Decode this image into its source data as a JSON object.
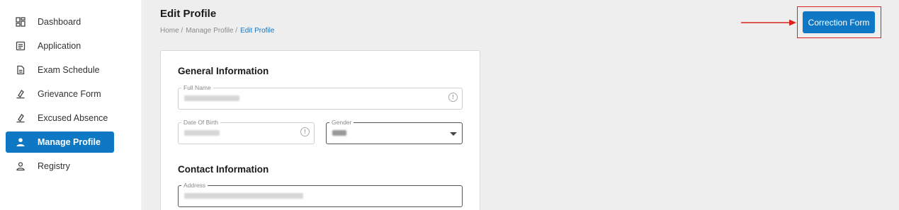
{
  "sidebar": {
    "items": [
      {
        "label": "Dashboard",
        "icon": "dashboard-icon"
      },
      {
        "label": "Application",
        "icon": "application-icon"
      },
      {
        "label": "Exam Schedule",
        "icon": "document-icon"
      },
      {
        "label": "Grievance Form",
        "icon": "stamp-icon"
      },
      {
        "label": "Excused Absence",
        "icon": "stamp-icon"
      },
      {
        "label": "Manage Profile",
        "icon": "user-icon",
        "active": true
      },
      {
        "label": "Registry",
        "icon": "user-outline-icon"
      }
    ]
  },
  "header": {
    "title": "Edit Profile",
    "breadcrumb": [
      "Home /",
      "Manage Profile /",
      "Edit Profile"
    ],
    "correction_button": "Correction Form"
  },
  "form": {
    "general_title": "General Information",
    "full_name_label": "Full Name",
    "dob_label": "Date Of Birth",
    "gender_label": "Gender",
    "contact_title": "Contact Information",
    "address_label": "Address"
  },
  "colors": {
    "accent": "#0f78c4",
    "annotation": "#dd2222",
    "background": "#eeeeee"
  }
}
